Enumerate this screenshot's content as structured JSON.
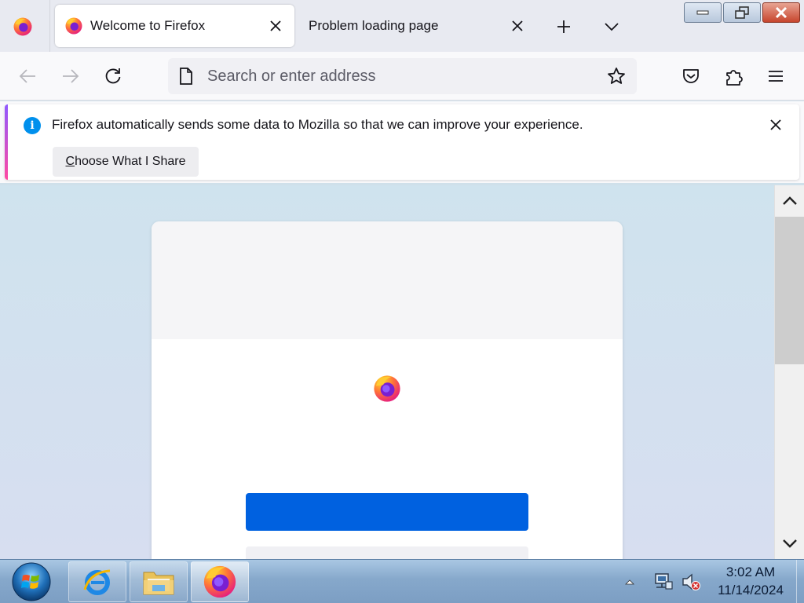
{
  "browser": {
    "menu_icon": "firefox-logo-icon",
    "tabs": [
      {
        "title": "Welcome to Firefox",
        "active": true,
        "favicon": "firefox-logo-icon"
      },
      {
        "title": "Problem loading page",
        "active": false
      }
    ],
    "new_tab_icon": "plus-icon",
    "list_all_tabs_icon": "chevron-down-icon",
    "window_controls": [
      "minimize-icon",
      "restore-icon",
      "close-icon"
    ]
  },
  "navbar": {
    "back_icon": "back-arrow-icon",
    "forward_icon": "forward-arrow-icon",
    "reload_icon": "reload-icon",
    "address_placeholder": "Search or enter address",
    "address_value": "",
    "page_icon": "page-icon",
    "bookmark_icon": "star-icon",
    "pocket_icon": "pocket-icon",
    "extensions_icon": "puzzle-icon",
    "menu_icon": "hamburger-icon"
  },
  "notification": {
    "message": "Firefox automatically sends some data to Mozilla so that we can improve your experience.",
    "button_first_letter": "C",
    "button_rest": "hoose What I Share",
    "info_glyph": "i"
  },
  "taskbar": {
    "apps": [
      "internet-explorer-icon",
      "file-explorer-icon",
      "firefox-icon"
    ],
    "clock_time": "3:02 AM",
    "clock_date": "11/14/2024",
    "tray_icons": [
      "show-hidden-icons-arrow",
      "network-icon",
      "volume-muted-icon"
    ]
  },
  "colors": {
    "accent_blue": "#0061e0",
    "info_blue": "#0090ed",
    "content_bg": "#cfe3ee"
  }
}
